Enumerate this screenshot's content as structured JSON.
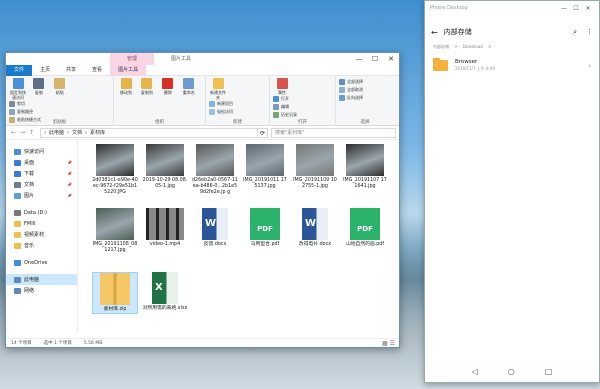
{
  "explorer": {
    "context_tab_head": "管理",
    "context_tab_title": "图片工具",
    "window_controls": [
      "—",
      "☐",
      "✕"
    ],
    "tabs": [
      {
        "label": "文件",
        "type": "file"
      },
      {
        "label": "主页",
        "type": "normal"
      },
      {
        "label": "共享",
        "type": "normal"
      },
      {
        "label": "查看",
        "type": "normal"
      },
      {
        "label": "图片工具",
        "type": "manage"
      }
    ],
    "ribbon": {
      "clipboard": {
        "group_label": "剪贴板",
        "big_buttons": [
          {
            "label": "固定到快速访问",
            "color": "#4a90d9"
          },
          {
            "label": "复制",
            "color": "#5c6f86"
          },
          {
            "label": "粘贴",
            "color": "#d7b46a"
          }
        ],
        "small_buttons": [
          "剪切",
          "复制路径",
          "粘贴快捷方式"
        ]
      },
      "organize": {
        "group_label": "组织",
        "buttons": [
          {
            "label": "移动到",
            "color": "#e6b54a"
          },
          {
            "label": "复制到",
            "color": "#e6b54a"
          },
          {
            "label": "删除",
            "color": "#d93025"
          },
          {
            "label": "重命名",
            "color": "#6b9bd1"
          }
        ]
      },
      "new": {
        "group_label": "新建",
        "buttons": [
          {
            "label": "新建文件夹",
            "color": "#f0c04f"
          }
        ],
        "small_buttons": [
          "新建项目",
          "轻松访问"
        ]
      },
      "open": {
        "group_label": "打开",
        "buttons": [
          {
            "label": "属性",
            "color": "#d9534f"
          }
        ],
        "small_buttons": [
          "打开",
          "编辑",
          "历史记录"
        ]
      },
      "select": {
        "group_label": "选择",
        "small_buttons": [
          "全部选择",
          "全部取消",
          "反向选择"
        ]
      }
    },
    "address": {
      "nav": [
        "←",
        "→",
        "↑"
      ],
      "path": [
        "›",
        "此电脑",
        "›",
        "文档",
        "›",
        "素材库"
      ],
      "search_placeholder": "搜索\"素材库\""
    },
    "nav_pane": [
      {
        "label": "快速访问",
        "color": "#4a90d9",
        "pinned": false,
        "selected": false
      },
      {
        "label": "桌面",
        "color": "#3a7bd5",
        "pinned": true,
        "selected": false
      },
      {
        "label": "下载",
        "color": "#3a7bd5",
        "pinned": true,
        "selected": false
      },
      {
        "label": "文档",
        "color": "#6b7d91",
        "pinned": true,
        "selected": false
      },
      {
        "label": "图片",
        "color": "#5aa0d8",
        "pinned": true,
        "selected": false
      },
      {
        "label": "Data (D:)",
        "color": "#777777",
        "pinned": false,
        "selected": false
      },
      {
        "label": "FMIII",
        "color": "#f0c04f",
        "pinned": false,
        "selected": false
      },
      {
        "label": "视频素材",
        "color": "#f0c04f",
        "pinned": false,
        "selected": false
      },
      {
        "label": "音乐",
        "color": "#f0c04f",
        "pinned": false,
        "selected": false
      },
      {
        "label": "OneDrive",
        "color": "#3b8fdc",
        "pinned": false,
        "selected": false
      },
      {
        "label": "此电脑",
        "color": "#5a8ac0",
        "pinned": false,
        "selected": true
      },
      {
        "label": "网络",
        "color": "#5a8ac0",
        "pinned": false,
        "selected": false
      }
    ],
    "files": [
      {
        "name": "2d0381c1-e90e-40ec-9672-f29e51b15220.JPG",
        "kind": "photo",
        "color": "#2c2c2c"
      },
      {
        "name": "2019-10-29 08.08.05-1.jpg",
        "kind": "photo",
        "color": "#3a3a3a"
      },
      {
        "name": "d26eb2a0-0567-11ea-b486-0...2b1e59d2fe2e.jp g",
        "kind": "photo",
        "color": "#565656"
      },
      {
        "name": "IMG_20191011 175137.jpg",
        "kind": "photo",
        "color": "#5b6870"
      },
      {
        "name": "IMG_20191109 102755-1.jpg",
        "kind": "photo",
        "color": "#777777"
      },
      {
        "name": "IMG_20191107 171641.jpg",
        "kind": "photo",
        "color": "#2d2d2d"
      },
      {
        "name": "IMG_20191108_081217.jpg",
        "kind": "photo",
        "color": "#4a5e55"
      },
      {
        "name": "video-1.mp4",
        "kind": "video",
        "color": "#8a8a8a"
      },
      {
        "name": "反馈.docx",
        "kind": "word",
        "color": "#2b579a"
      },
      {
        "name": "马用型合.pdf",
        "kind": "pdf",
        "color": "#2bb36c"
      },
      {
        "name": "改得电补.docx",
        "kind": "word",
        "color": "#2b579a"
      },
      {
        "name": "山地自然的画.pdf",
        "kind": "pdf",
        "color": "#2bb36c"
      },
      {
        "name": "素材库.zip",
        "kind": "zip",
        "color": "#f5c865",
        "selected": true
      },
      {
        "name": "对所用需的表格.xlsx",
        "kind": "excel",
        "color": "#217346"
      }
    ],
    "status": {
      "count": "14 个项目",
      "selected": "选中 1 个项目",
      "size": "5.56 MB",
      "views": "▦ ☰"
    }
  },
  "phone": {
    "title": "Phone Desktop",
    "controls": [
      "—",
      "☐",
      "✕"
    ],
    "header_title": "内部存储",
    "back_icon": "←",
    "icons": [
      "⌕",
      "⋮"
    ],
    "breadcrumb": [
      "内部存储",
      ">",
      "Download",
      ">"
    ],
    "rows": [
      {
        "name": "Browser",
        "date": "2019/11/7 上午 8:49"
      }
    ],
    "chevron": "›",
    "navbar": [
      "◁",
      "○",
      "□"
    ]
  }
}
